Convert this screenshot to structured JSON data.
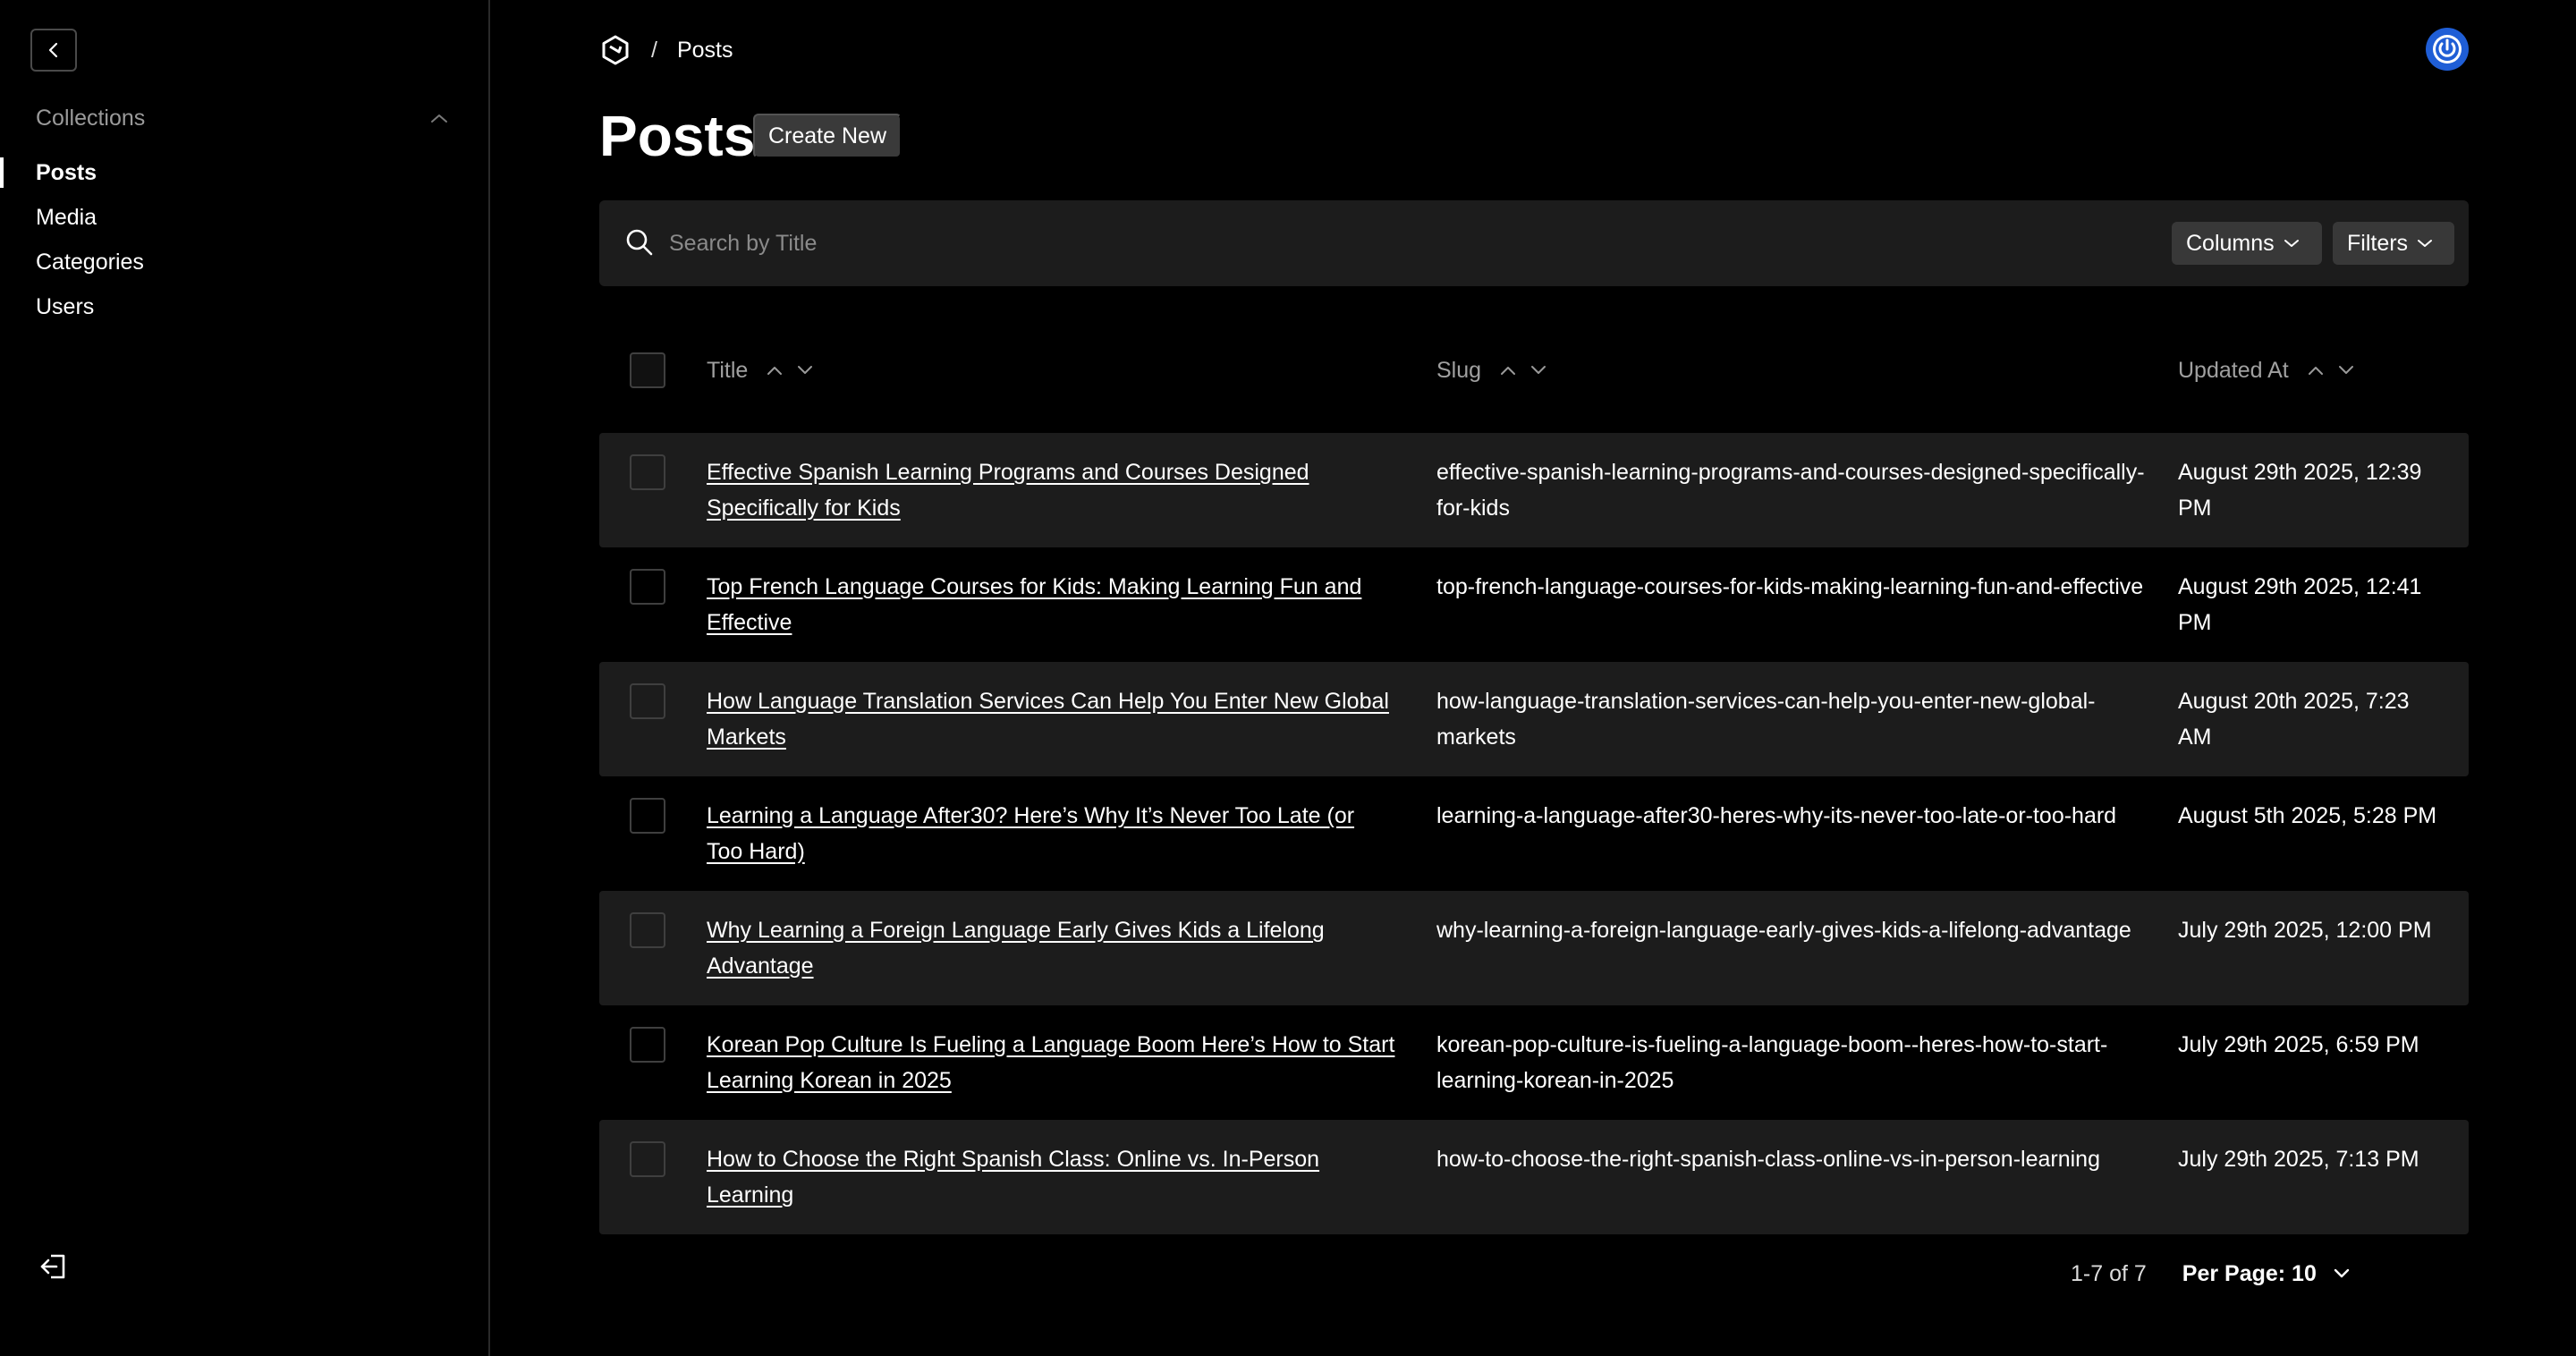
{
  "sidebar": {
    "group_label": "Collections",
    "items": [
      {
        "label": "Posts",
        "active": true
      },
      {
        "label": "Media",
        "active": false
      },
      {
        "label": "Categories",
        "active": false
      },
      {
        "label": "Users",
        "active": false
      }
    ],
    "icons": {
      "back": "chevron-left-icon",
      "collapse": "chevron-up-icon",
      "logout": "logout-icon"
    }
  },
  "header": {
    "breadcrumb_separator": "/",
    "breadcrumb_current": "Posts",
    "title": "Posts",
    "create_new_label": "Create New",
    "account_color": "#1f5ed6"
  },
  "search": {
    "placeholder": "Search by Title",
    "value": "",
    "columns_label": "Columns",
    "filters_label": "Filters"
  },
  "table": {
    "headers": {
      "title": "Title",
      "slug": "Slug",
      "updated_at": "Updated At"
    },
    "rows": [
      {
        "title": "Effective Spanish Learning Programs and Courses Designed Specifically for Kids",
        "slug": "effective-spanish-learning-programs-and-courses-designed-specifically-for-kids",
        "updated_at": "August 29th 2025, 12:39 PM"
      },
      {
        "title": "Top French Language Courses for Kids: Making Learning Fun and Effective",
        "slug": "top-french-language-courses-for-kids-making-learning-fun-and-effective",
        "updated_at": "August 29th 2025, 12:41 PM"
      },
      {
        "title": "How Language Translation Services Can Help You Enter New Global Markets",
        "slug": "how-language-translation-services-can-help-you-enter-new-global-markets",
        "updated_at": "August 20th 2025, 7:23 AM"
      },
      {
        "title": "Learning a Language After30? Here’s Why It’s Never Too Late (or Too Hard)",
        "slug": "learning-a-language-after30-heres-why-its-never-too-late-or-too-hard",
        "updated_at": "August 5th 2025, 5:28 PM"
      },
      {
        "title": "Why Learning a Foreign Language Early Gives Kids a Lifelong Advantage",
        "slug": "why-learning-a-foreign-language-early-gives-kids-a-lifelong-advantage",
        "updated_at": "July 29th 2025, 12:00 PM"
      },
      {
        "title": "Korean Pop Culture Is Fueling a Language Boom Here’s How to Start Learning Korean in 2025",
        "slug": "korean-pop-culture-is-fueling-a-language-boom--heres-how-to-start-learning-korean-in-2025",
        "updated_at": "July 29th 2025, 6:59 PM"
      },
      {
        "title": "How to Choose the Right Spanish Class: Online vs. In-Person Learning",
        "slug": "how-to-choose-the-right-spanish-class-online-vs-in-person-learning",
        "updated_at": "July 29th 2025, 7:13 PM"
      }
    ]
  },
  "pagination": {
    "range": "1-7 of 7",
    "per_page": "Per Page: 10"
  }
}
